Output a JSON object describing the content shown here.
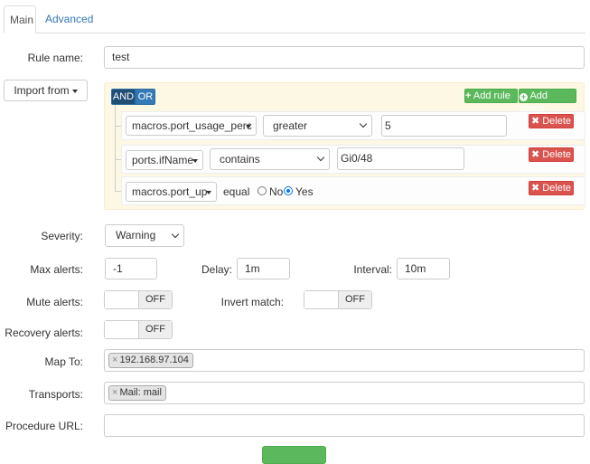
{
  "tabs": {
    "main": "Main",
    "advanced": "Advanced"
  },
  "rule_name": {
    "label": "Rule name:",
    "value": "test"
  },
  "import_from": {
    "label": "Import from"
  },
  "query_builder": {
    "and_label": "AND",
    "or_label": "OR",
    "add_rule": "Add rule",
    "add_group": "Add group",
    "delete_label": "Delete",
    "rules": [
      {
        "field": "macros.port_usage_perc",
        "operator": "greater",
        "value": "5"
      },
      {
        "field": "ports.ifName",
        "operator": "contains",
        "value": "Gi0/48"
      },
      {
        "field": "macros.port_up",
        "operator": "equal",
        "option_no": "No",
        "option_yes": "Yes",
        "selected": "Yes"
      }
    ]
  },
  "severity": {
    "label": "Severity:",
    "value": "Warning"
  },
  "max_alerts": {
    "label": "Max alerts:",
    "value": "-1"
  },
  "delay": {
    "label": "Delay:",
    "value": "1m"
  },
  "interval": {
    "label": "Interval:",
    "value": "10m"
  },
  "mute_alerts": {
    "label": "Mute alerts:",
    "state": "OFF"
  },
  "invert_match": {
    "label": "Invert match:",
    "state": "OFF"
  },
  "recovery_alerts": {
    "label": "Recovery alerts:",
    "state": "OFF"
  },
  "map_to": {
    "label": "Map To:",
    "tags": [
      "192.168.97.104"
    ]
  },
  "transports": {
    "label": "Transports:",
    "tags": [
      "Mail: mail"
    ]
  },
  "procedure_url": {
    "label": "Procedure URL:",
    "value": ""
  },
  "colors": {
    "primary": "#337ab7",
    "success": "#5cb85c",
    "danger": "#d9534f",
    "qb_background": "#fcf8e3"
  }
}
